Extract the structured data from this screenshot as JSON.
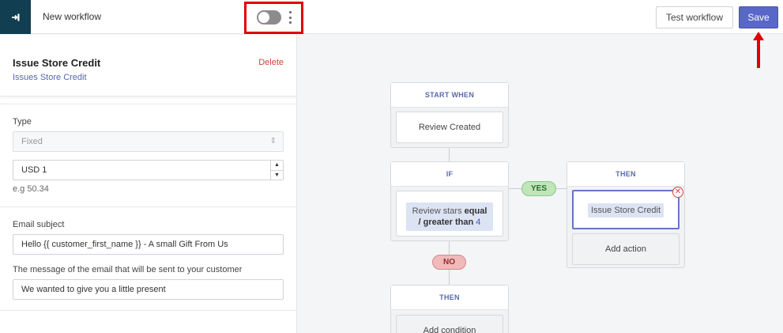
{
  "header": {
    "title": "New workflow",
    "test_label": "Test workflow",
    "save_label": "Save"
  },
  "panel": {
    "title": "Issue Store Credit",
    "subtitle": "Issues Store Credit",
    "delete_label": "Delete",
    "type_label": "Type",
    "type_value": "Fixed",
    "amount_value": "USD 1",
    "amount_hint": "e.g 50.34",
    "email_subject_label": "Email subject",
    "email_subject_value": "Hello {{ customer_first_name }} - A small Gift From Us",
    "message_label": "The message of the email that will be sent to your customer",
    "message_value": "We wanted to give you a little present"
  },
  "flow": {
    "start_head": "START WHEN",
    "start_trigger": "Review Created",
    "if_head": "IF",
    "cond_pre": "Review stars",
    "cond_bold1": "equal",
    "cond_bold2": "/ greater than",
    "cond_num": "4",
    "yes_label": "YES",
    "no_label": "NO",
    "then_head": "THEN",
    "action_chip": "Issue Store Credit",
    "add_action": "Add action",
    "then2_head": "THEN",
    "add_condition": "Add condition"
  },
  "colors": {
    "accent": "#5867c8",
    "back_button": "#123e52",
    "highlight_box": "#e00000",
    "delete_red": "#d0443a"
  }
}
